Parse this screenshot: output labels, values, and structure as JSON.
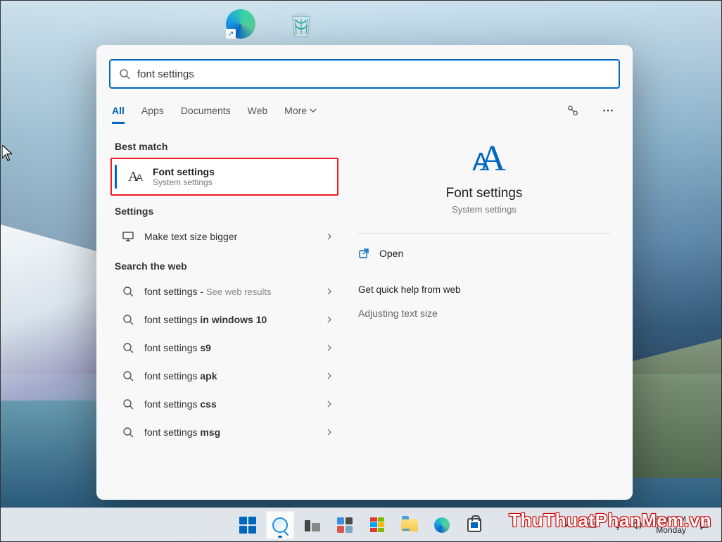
{
  "desktop": {
    "icons": [
      {
        "name": "edge-shortcut"
      },
      {
        "name": "recycle-bin"
      }
    ]
  },
  "search": {
    "query": "font settings",
    "tabs": {
      "all": "All",
      "apps": "Apps",
      "documents": "Documents",
      "web": "Web",
      "more": "More"
    },
    "section_best_match": "Best match",
    "best_match": {
      "title": "Font settings",
      "subtitle": "System settings"
    },
    "section_settings": "Settings",
    "settings_items": [
      {
        "label": "Make text size bigger"
      }
    ],
    "section_web": "Search the web",
    "web_items": [
      {
        "prefix": "font settings",
        "suffix": "",
        "hint": "See web results"
      },
      {
        "prefix": "font settings ",
        "suffix": "in windows 10",
        "hint": ""
      },
      {
        "prefix": "font settings ",
        "suffix": "s9",
        "hint": ""
      },
      {
        "prefix": "font settings ",
        "suffix": "apk",
        "hint": ""
      },
      {
        "prefix": "font settings ",
        "suffix": "css",
        "hint": ""
      },
      {
        "prefix": "font settings ",
        "suffix": "msg",
        "hint": ""
      }
    ],
    "preview": {
      "title": "Font settings",
      "subtitle": "System settings",
      "open_label": "Open",
      "help_heading": "Get quick help from web",
      "help_links": [
        "Adjusting text size"
      ]
    }
  },
  "taskbar": {
    "tray_time": "5:20 PM",
    "tray_day": "Monday"
  },
  "watermark": "ThuThuatPhanMem.vn"
}
